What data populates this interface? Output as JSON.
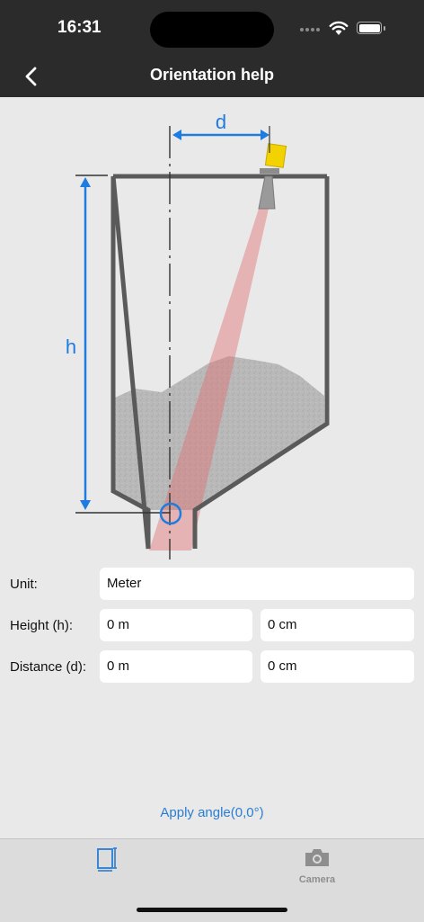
{
  "status": {
    "time": "16:31"
  },
  "nav": {
    "title": "Orientation help"
  },
  "diagram": {
    "labels": {
      "d": "d",
      "h": "h"
    }
  },
  "form": {
    "unit": {
      "label": "Unit:",
      "value": "Meter"
    },
    "height": {
      "label": "Height (h):",
      "meters": "0 m",
      "centimeters": "0 cm"
    },
    "distance": {
      "label": "Distance (d):",
      "meters": "0 m",
      "centimeters": "0 cm"
    }
  },
  "apply_label": "Apply angle(0,0°)",
  "tabs": [
    {
      "label": "",
      "icon": "tank-view-icon"
    },
    {
      "label": "Camera",
      "icon": "camera-icon"
    }
  ],
  "colors": {
    "accent": "#2a7dd1",
    "bars": "#2b2b2b",
    "dimension": "#1e7be0",
    "sensor": "#f2d200"
  }
}
